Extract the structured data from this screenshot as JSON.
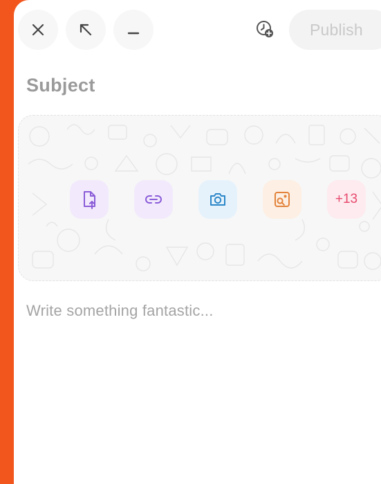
{
  "toolbar": {
    "close_icon": "close-icon",
    "expand_icon": "arrow-up-left-icon",
    "minimize_icon": "minimize-icon",
    "schedule_icon": "clock-plus-icon",
    "publish_label": "Publish"
  },
  "editor": {
    "subject_placeholder": "Subject",
    "body_placeholder": "Write something fantastic..."
  },
  "media": {
    "buttons": [
      {
        "icon": "file-upload-icon",
        "color": "#8a5cd8",
        "bg": "#f2eafc"
      },
      {
        "icon": "link-icon",
        "color": "#8a5cd8",
        "bg": "#f2eafc"
      },
      {
        "icon": "camera-icon",
        "color": "#2a86c8",
        "bg": "#e6f2fb"
      },
      {
        "icon": "image-search-icon",
        "color": "#e3823b",
        "bg": "#fdefe3"
      },
      {
        "label": "+13",
        "color": "#e84a6e",
        "bg": "#fdebef"
      }
    ]
  },
  "colors": {
    "frame": "#f2561d",
    "panel": "#ffffff"
  }
}
